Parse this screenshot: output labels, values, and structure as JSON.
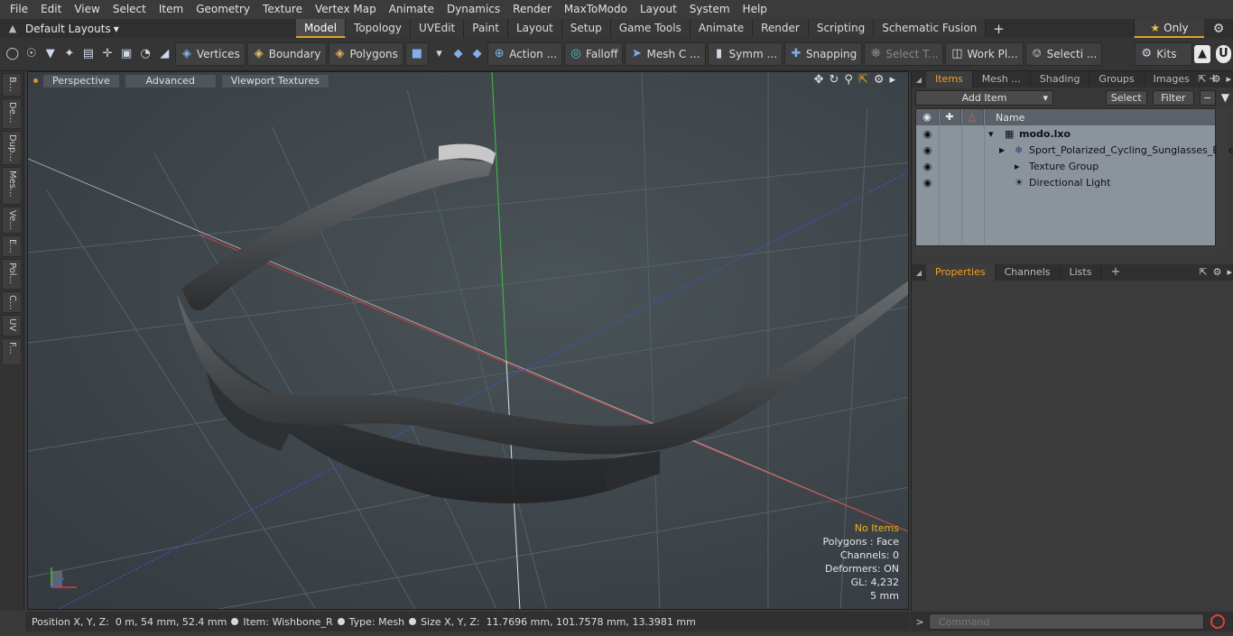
{
  "menu": [
    "File",
    "Edit",
    "View",
    "Select",
    "Item",
    "Geometry",
    "Texture",
    "Vertex Map",
    "Animate",
    "Dynamics",
    "Render",
    "MaxToModo",
    "Layout",
    "System",
    "Help"
  ],
  "layouts": {
    "label": "Default Layouts"
  },
  "layout_tabs": [
    "Model",
    "Topology",
    "UVEdit",
    "Paint",
    "Layout",
    "Setup",
    "Game Tools",
    "Animate",
    "Render",
    "Scripting",
    "Schematic Fusion"
  ],
  "active_tab": "Model",
  "only_label": "Only",
  "toolbar": {
    "vertices": "Vertices",
    "boundary": "Boundary",
    "polygons": "Polygons",
    "action": "Action ...",
    "falloff": "Falloff",
    "mesh": "Mesh C ...",
    "symm": "Symm ...",
    "snapping": "Snapping",
    "select_t": "Select T...",
    "work_pl": "Work Pl...",
    "selecti": "Selecti ...",
    "kits": "Kits"
  },
  "left_tabs": [
    "B...",
    "De...",
    "Dup...",
    "Mes...",
    "Ve...",
    "E...",
    "Pol...",
    "C...",
    "UV",
    "F..."
  ],
  "viewport": {
    "perspective": "Perspective",
    "advanced": "Advanced",
    "textures": "Viewport Textures",
    "info": {
      "no_items": "No Items",
      "polygons": "Polygons : Face",
      "channels": "Channels: 0",
      "deformers": "Deformers: ON",
      "gl": "GL: 4,232",
      "scale": "5 mm"
    }
  },
  "status": {
    "position_label": "Position X, Y, Z:",
    "position_value": "0 m, 54 mm, 52.4 mm",
    "item_label": "Item:",
    "item_value": "Wishbone_R",
    "type_label": "Type:",
    "type_value": "Mesh",
    "size_label": "Size X, Y, Z:",
    "size_value": "11.7696 mm, 101.7578 mm, 13.3981 mm"
  },
  "items_panel": {
    "tabs": [
      "Items",
      "Mesh ...",
      "Shading",
      "Groups",
      "Images"
    ],
    "add_item": "Add Item",
    "select": "Select",
    "filter": "Filter",
    "name_header": "Name",
    "rows": [
      {
        "label": "modo.lxo"
      },
      {
        "label": "Sport_Polarized_Cycling_Sunglasses_Blue"
      },
      {
        "label": "Texture Group"
      },
      {
        "label": "Directional Light"
      }
    ]
  },
  "props_panel": {
    "tabs": [
      "Properties",
      "Channels",
      "Lists"
    ]
  },
  "command": {
    "placeholder": "Command"
  }
}
